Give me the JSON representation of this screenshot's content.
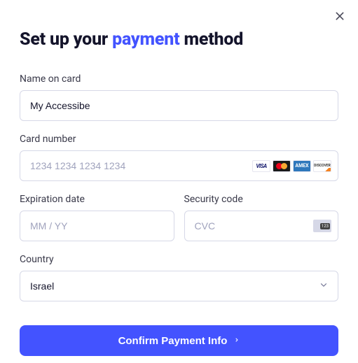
{
  "title": {
    "part1": "Set up your ",
    "highlight": "payment",
    "part2": " method"
  },
  "fields": {
    "name": {
      "label": "Name on card",
      "value": "My Accessibe"
    },
    "card": {
      "label": "Card number",
      "placeholder": "1234 1234 1234 1234"
    },
    "expiration": {
      "label": "Expiration date",
      "placeholder": "MM / YY"
    },
    "cvc": {
      "label": "Security code",
      "placeholder": "CVC",
      "icon_digits": "123"
    },
    "country": {
      "label": "Country",
      "value": "Israel"
    }
  },
  "brands": {
    "visa": "VISA",
    "amex": "AMEX",
    "discover": "DISCOVER"
  },
  "confirm_label": "Confirm Payment Info"
}
